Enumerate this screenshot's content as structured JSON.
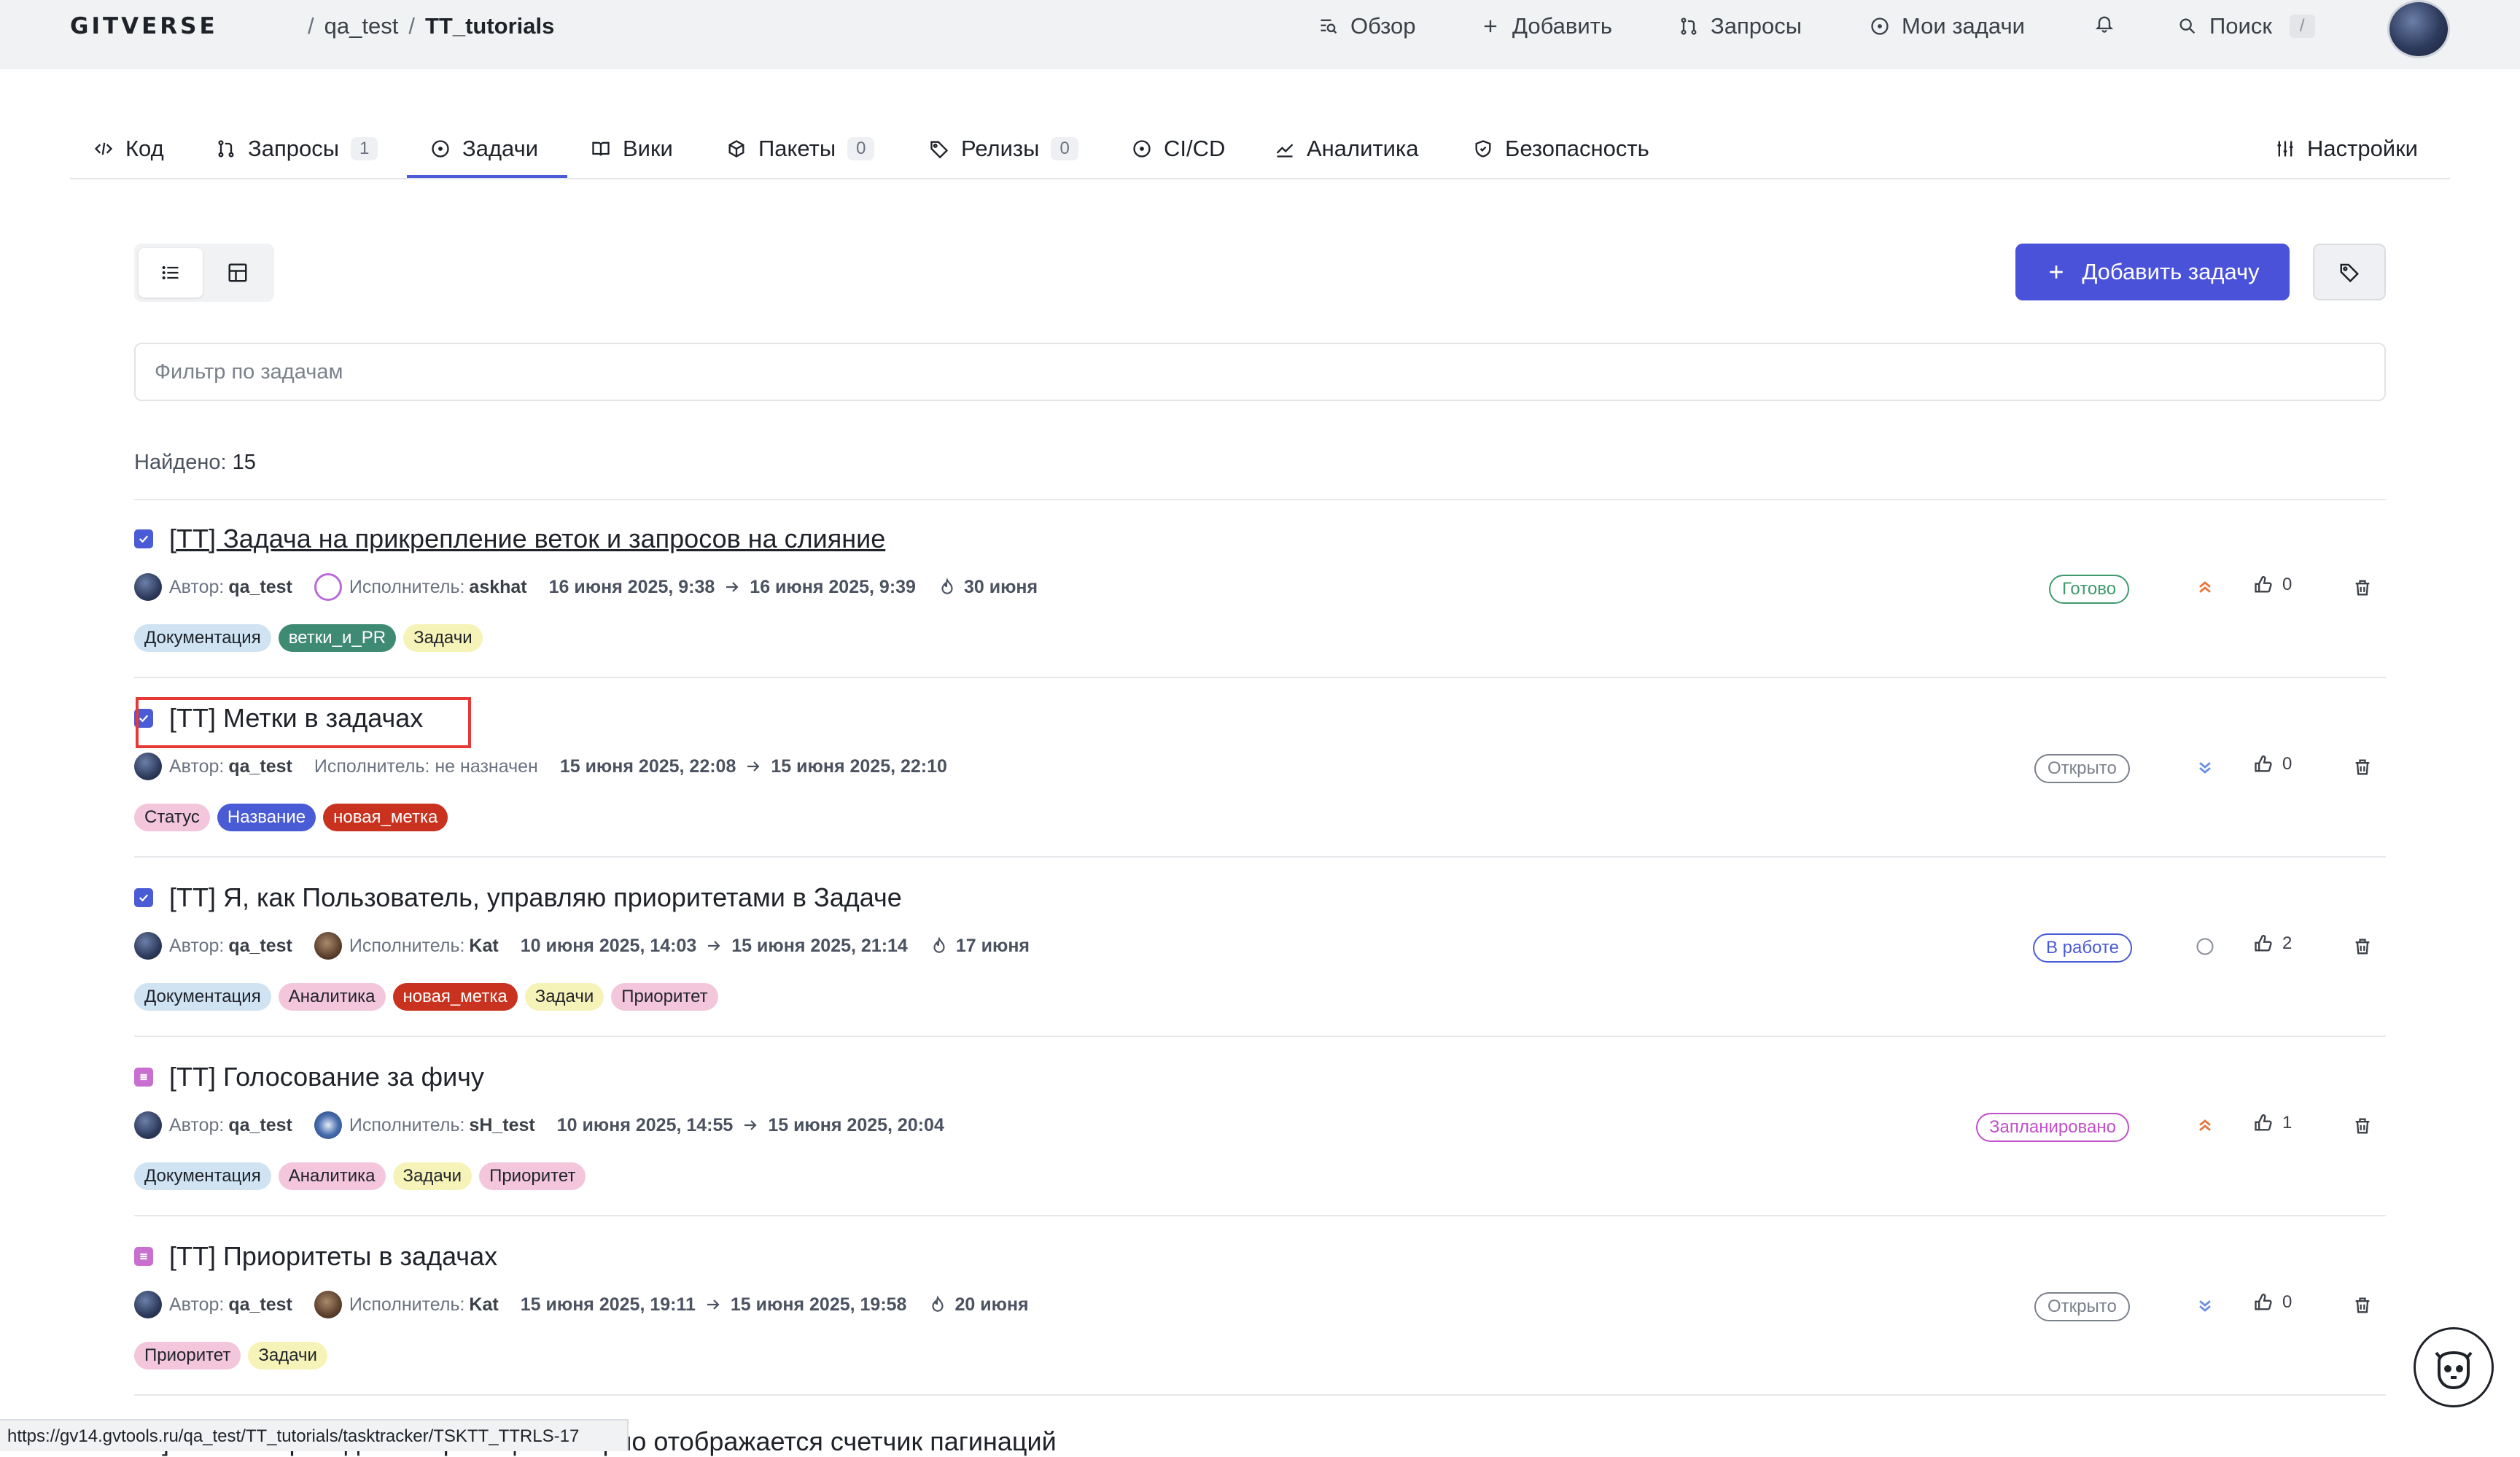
{
  "header": {
    "logo": "GITVERSE",
    "breadcrumb": [
      "qa_test",
      "TT_tutorials"
    ],
    "breadcrumb_sep": "/",
    "nav": {
      "overview": "Обзор",
      "add": "Добавить",
      "requests": "Запросы",
      "my_tasks": "Мои задачи",
      "search": "Поиск",
      "search_kbd": "/"
    }
  },
  "tabs": [
    {
      "label": "Код"
    },
    {
      "label": "Запросы",
      "count": "1"
    },
    {
      "label": "Задачи",
      "active": true
    },
    {
      "label": "Вики"
    },
    {
      "label": "Пакеты",
      "count": "0"
    },
    {
      "label": "Релизы",
      "count": "0"
    },
    {
      "label": "CI/CD"
    },
    {
      "label": "Аналитика"
    },
    {
      "label": "Безопасность"
    },
    {
      "label": "Настройки"
    }
  ],
  "toolbar": {
    "add_task": "Добавить задачу"
  },
  "filter": {
    "placeholder": "Фильтр по задачам",
    "value": ""
  },
  "found": {
    "label": "Найдено:",
    "count": "15"
  },
  "meta_labels": {
    "author": "Автор:",
    "assignee": "Исполнитель:",
    "unassigned": "Исполнитель: не назначен"
  },
  "issues": [
    {
      "title": "[TT] Задача на прикрепление веток и запросов на слияние",
      "type": "task",
      "author": "qa_test",
      "assignee": "askhat",
      "start": "16 июня 2025, 9:38",
      "end": "16 июня 2025, 9:39",
      "due": "30 июня",
      "labels": [
        {
          "text": "Документация",
          "bg": "#cfe3f3",
          "fg": "#1f2329"
        },
        {
          "text": "ветки_и_PR",
          "bg": "#3f8a72",
          "fg": "#ffffff"
        },
        {
          "text": "Задачи",
          "bg": "#f6f3b8",
          "fg": "#1f2329"
        }
      ],
      "status": "Готово",
      "status_color": "#3f9a6e",
      "priority": "high",
      "likes": "0"
    },
    {
      "title": "[TT] Метки в задачах",
      "type": "task",
      "author": "qa_test",
      "assignee": "",
      "start": "15 июня 2025, 22:08",
      "end": "15 июня 2025, 22:10",
      "due": "",
      "labels": [
        {
          "text": "Статус",
          "bg": "#f3c6dc",
          "fg": "#1f2329"
        },
        {
          "text": "Название",
          "bg": "#4a5bd6",
          "fg": "#ffffff"
        },
        {
          "text": "новая_метка",
          "bg": "#c8321e",
          "fg": "#ffffff"
        }
      ],
      "status": "Открыто",
      "status_color": "#7b818b",
      "priority": "low",
      "likes": "0"
    },
    {
      "title": "[TT] Я, как Пользователь, управляю приоритетами в Задаче",
      "type": "task",
      "author": "qa_test",
      "assignee": "Kat",
      "start": "10 июня 2025, 14:03",
      "end": "15 июня 2025, 21:14",
      "due": "17 июня",
      "labels": [
        {
          "text": "Документация",
          "bg": "#cfe3f3",
          "fg": "#1f2329"
        },
        {
          "text": "Аналитика",
          "bg": "#f3c6dc",
          "fg": "#1f2329"
        },
        {
          "text": "новая_метка",
          "bg": "#c8321e",
          "fg": "#ffffff"
        },
        {
          "text": "Задачи",
          "bg": "#f6f3b8",
          "fg": "#1f2329"
        },
        {
          "text": "Приоритет",
          "bg": "#f3c6dc",
          "fg": "#1f2329"
        }
      ],
      "status": "В работе",
      "status_color": "#4a5bd6",
      "priority": "none",
      "likes": "2"
    },
    {
      "title": "[TT] Голосование за фичу",
      "type": "story",
      "author": "qa_test",
      "assignee": "sH_test",
      "start": "10 июня 2025, 14:55",
      "end": "15 июня 2025, 20:04",
      "due": "",
      "labels": [
        {
          "text": "Документация",
          "bg": "#cfe3f3",
          "fg": "#1f2329"
        },
        {
          "text": "Аналитика",
          "bg": "#f3c6dc",
          "fg": "#1f2329"
        },
        {
          "text": "Задачи",
          "bg": "#f6f3b8",
          "fg": "#1f2329"
        },
        {
          "text": "Приоритет",
          "bg": "#f3c6dc",
          "fg": "#1f2329"
        }
      ],
      "status": "Запланировано",
      "status_color": "#c04fc8",
      "priority": "high",
      "likes": "1"
    },
    {
      "title": "[TT] Приоритеты в задачах",
      "type": "story",
      "author": "qa_test",
      "assignee": "Kat",
      "start": "15 июня 2025, 19:11",
      "end": "15 июня 2025, 19:58",
      "due": "20 июня",
      "labels": [
        {
          "text": "Приоритет",
          "bg": "#f3c6dc",
          "fg": "#1f2329"
        },
        {
          "text": "Задачи",
          "bg": "#f6f3b8",
          "fg": "#1f2329"
        }
      ],
      "status": "Открыто",
      "status_color": "#7b818b",
      "priority": "low",
      "likes": "0"
    }
  ],
  "partial_issue_title": "ах] После перехода по странице не верно отображается счетчик пагинаций",
  "statusbar_url": "https://gv14.gvtools.ru/qa_test/TT_tutorials/tasktracker/TSKTT_TTRLS-17",
  "colors": {
    "accent": "#4a52d9",
    "highlight": "#e53935",
    "priority_high": "#e8733a",
    "priority_low": "#6b8fe0"
  },
  "icons": [
    "overview-icon",
    "plus-icon",
    "merge-request-icon",
    "task-circle-icon",
    "bell-icon",
    "search-icon",
    "code-icon",
    "wiki-book-icon",
    "package-icon",
    "tag-icon",
    "cicd-icon",
    "analytics-icon",
    "shield-icon",
    "settings-sliders-icon",
    "list-view-icon",
    "board-view-icon",
    "checkbox-task-icon",
    "story-icon",
    "arrow-right-icon",
    "due-flame-icon",
    "priority-high-icon",
    "priority-low-icon",
    "priority-none-icon",
    "thumbs-up-icon",
    "trash-icon",
    "mascot-icon"
  ]
}
